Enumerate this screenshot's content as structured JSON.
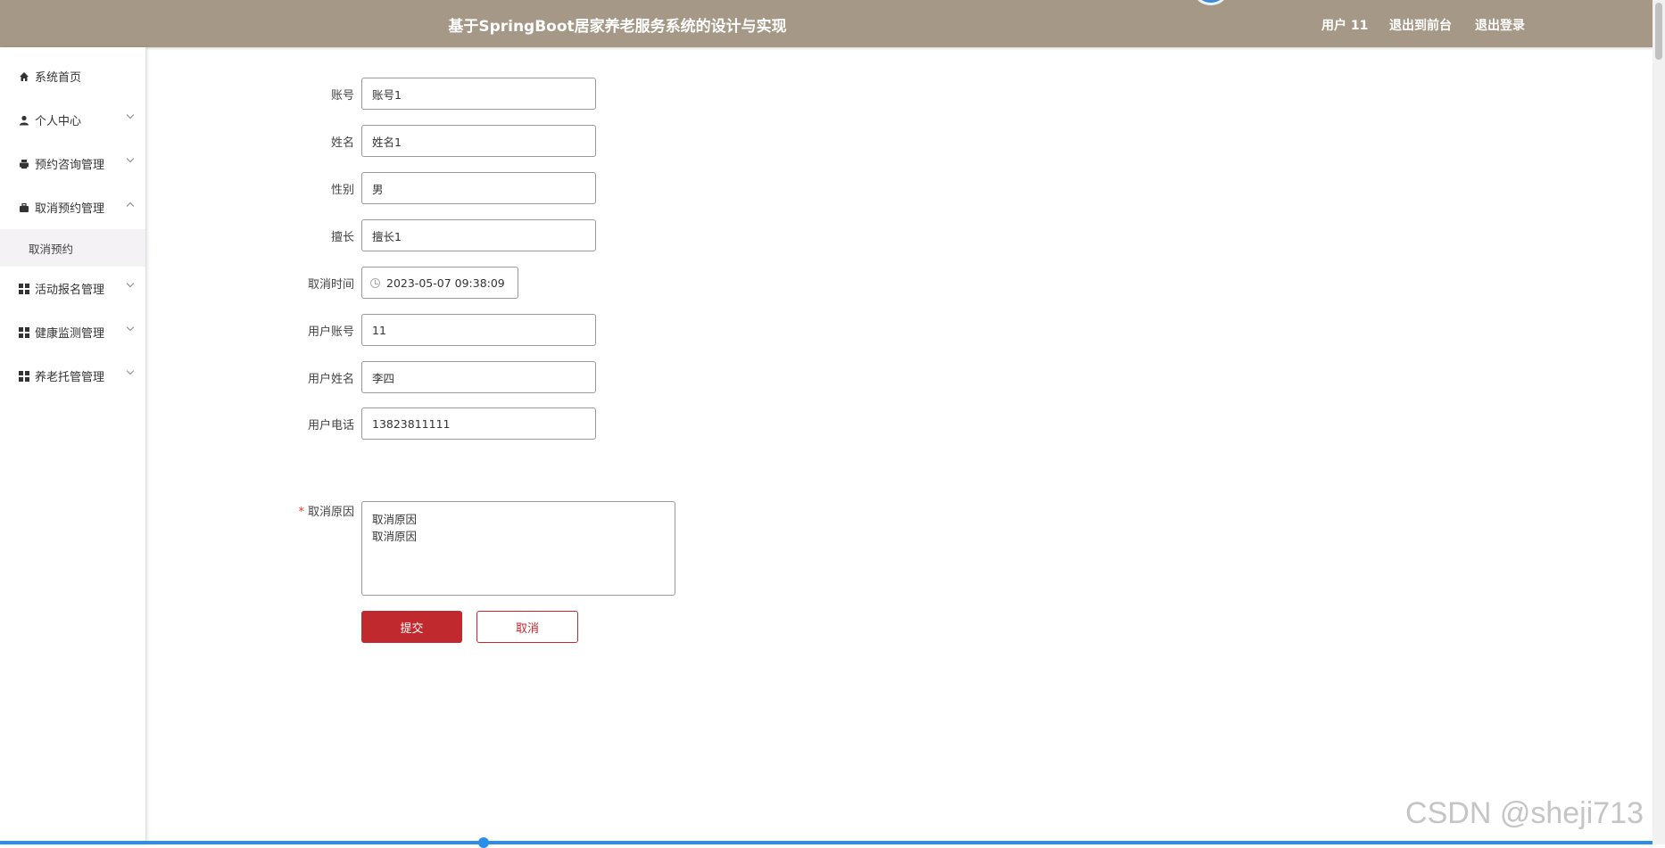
{
  "header": {
    "title": "基于SpringBoot居家养老服务系统的设计与实现",
    "user": "用户 11",
    "front_link": "退出到前台",
    "logout_link": "退出登录"
  },
  "sidebar": {
    "items": [
      {
        "label": "系统首页",
        "icon": "home-icon"
      },
      {
        "label": "个人中心",
        "icon": "user-icon"
      },
      {
        "label": "预约咨询管理",
        "icon": "printer-icon"
      },
      {
        "label": "取消预约管理",
        "icon": "briefcase-icon"
      },
      {
        "label": "活动报名管理",
        "icon": "grid-icon"
      },
      {
        "label": "健康监测管理",
        "icon": "grid-icon"
      },
      {
        "label": "养老托管管理",
        "icon": "grid-icon"
      }
    ],
    "submenu_item": "取消预约"
  },
  "form": {
    "account": {
      "label": "账号",
      "value": "账号1"
    },
    "name": {
      "label": "姓名",
      "value": "姓名1"
    },
    "gender": {
      "label": "性别",
      "value": "男"
    },
    "specialty": {
      "label": "擅长",
      "value": "擅长1"
    },
    "cancel_time": {
      "label": "取消时间",
      "value": "2023-05-07 09:38:09"
    },
    "user_account": {
      "label": "用户账号",
      "value": "11"
    },
    "user_name": {
      "label": "用户姓名",
      "value": "李四"
    },
    "user_phone": {
      "label": "用户电话",
      "value": "13823811111"
    },
    "cancel_reason": {
      "label": "取消原因",
      "required_mark": "*",
      "value": "取消原因\n取消原因"
    },
    "submit_label": "提交",
    "cancel_label": "取消"
  },
  "watermark": "CSDN @sheji713",
  "colors": {
    "header_bg": "#a59886",
    "primary": "#c0292e",
    "submenu_bg": "#f4f2f4"
  }
}
